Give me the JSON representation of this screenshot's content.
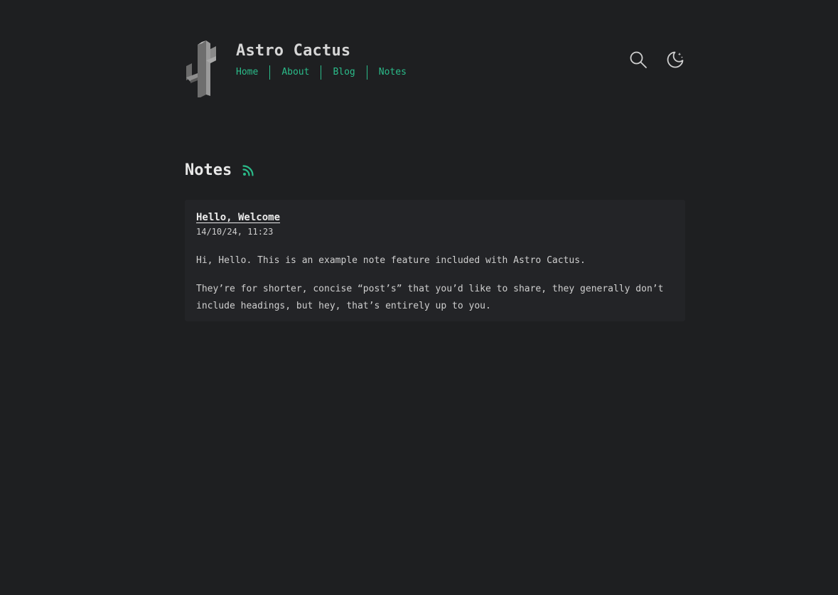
{
  "site": {
    "title": "Astro Cactus"
  },
  "nav": {
    "items": [
      {
        "label": "Home"
      },
      {
        "label": "About"
      },
      {
        "label": "Blog"
      },
      {
        "label": "Notes"
      }
    ]
  },
  "tools": {
    "search_icon": "search-icon",
    "theme_icon": "moon-icon"
  },
  "page": {
    "heading": "Notes",
    "rss_icon": "rss-icon"
  },
  "note": {
    "title": "Hello, Welcome",
    "date": "14/10/24, 11:23",
    "paragraphs": [
      "Hi, Hello. This is an example note feature included with Astro Cactus.",
      "They’re for shorter, concise “post’s” that you’d like to share, they generally don’t include headings, but hey, that’s entirely up to you."
    ]
  },
  "colors": {
    "background": "#1e1f21",
    "accent": "#2bbc8a",
    "card": "#232427"
  }
}
